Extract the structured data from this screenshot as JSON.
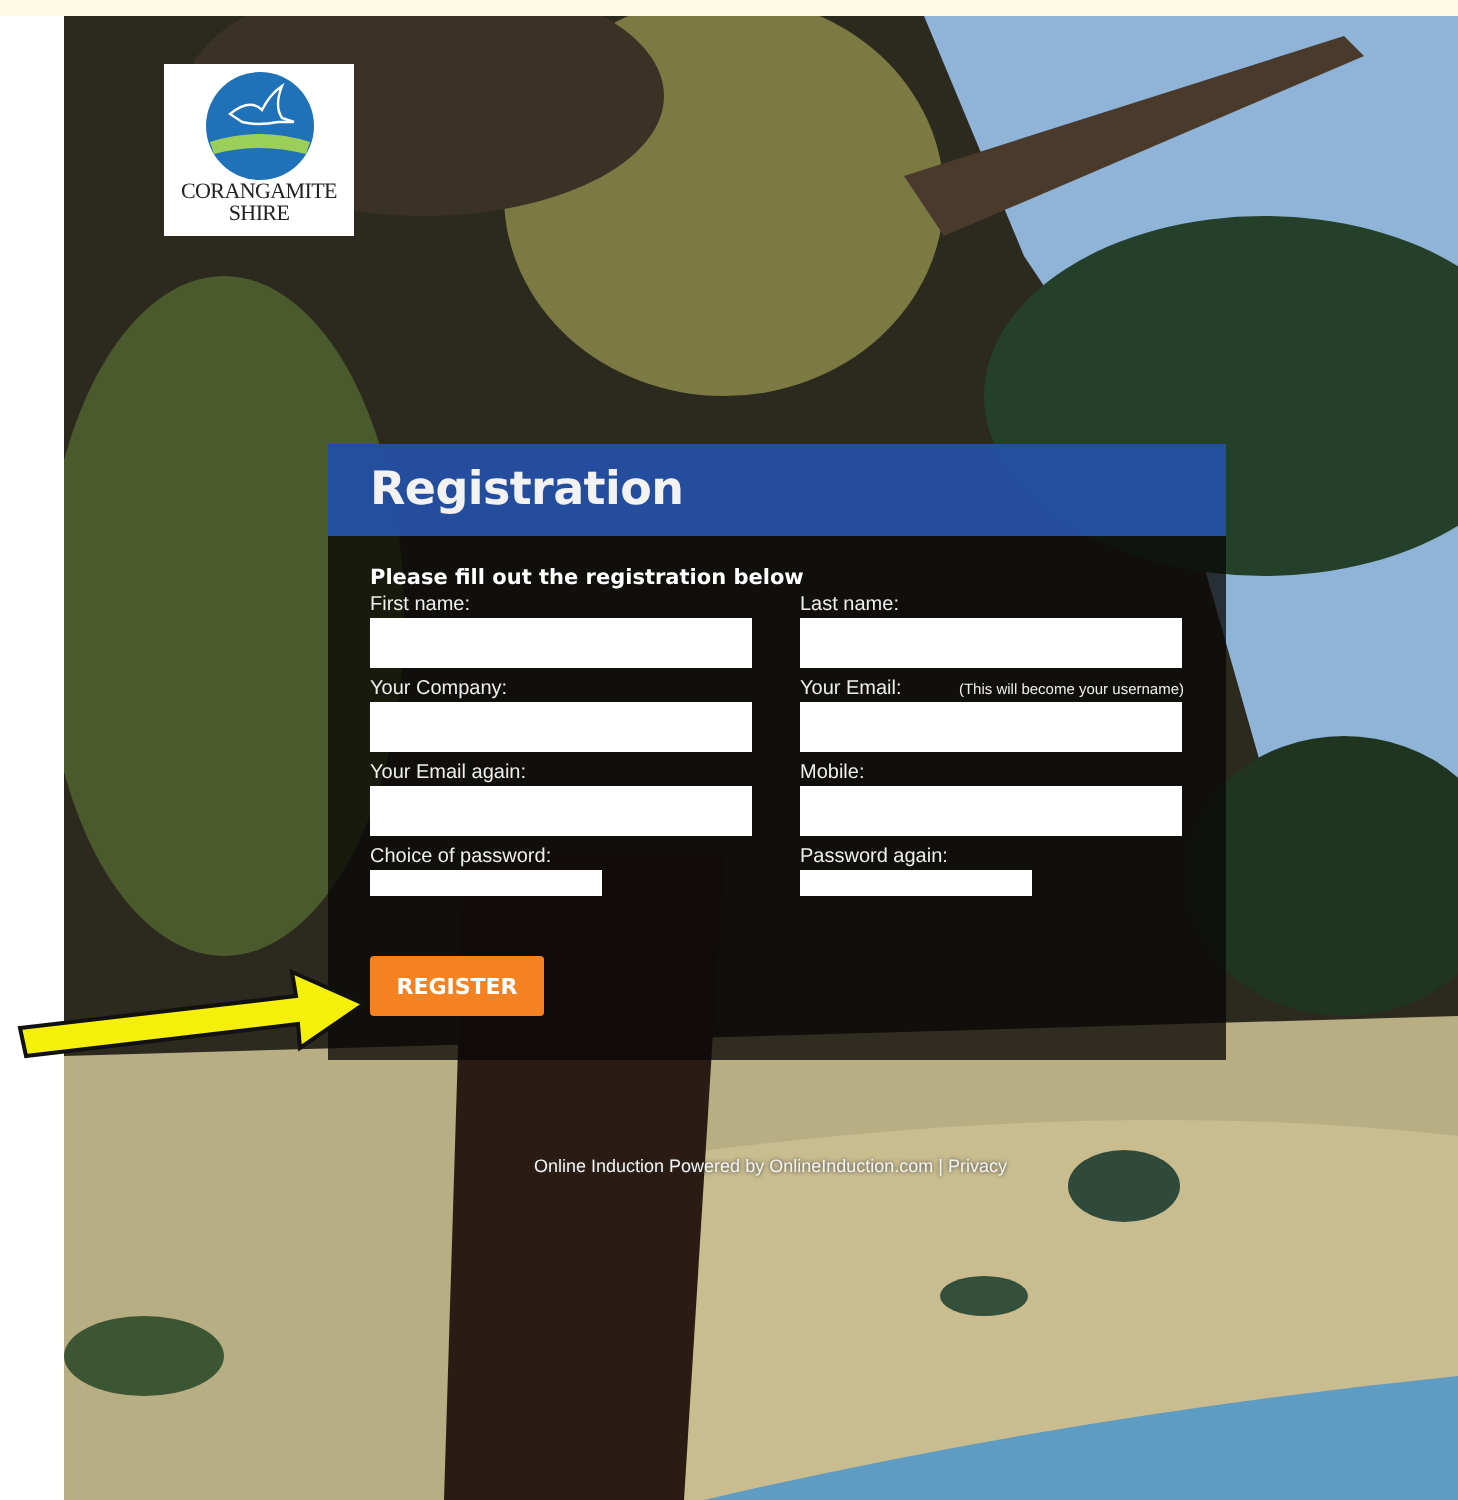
{
  "logo": {
    "lines": [
      "CORANGAMITE",
      "SHIRE"
    ]
  },
  "form": {
    "title": "Registration",
    "intro": "Please fill out the registration below",
    "fields": [
      {
        "label": "First name:",
        "kind": "text"
      },
      {
        "label": "Last name:",
        "kind": "text"
      },
      {
        "label": "Your Company:",
        "kind": "text"
      },
      {
        "label": "Your Email:",
        "note": "(This will become your username)",
        "kind": "text"
      },
      {
        "label": "Your Email again:",
        "kind": "text"
      },
      {
        "label": "Mobile:",
        "kind": "text"
      },
      {
        "label": "Choice of password:",
        "kind": "password"
      },
      {
        "label": "Password again:",
        "kind": "password"
      }
    ],
    "submit": "REGISTER"
  },
  "footer": {
    "text": "Online Induction Powered by",
    "link": "OnlineInduction.com",
    "separator": "|",
    "privacy": "Privacy"
  }
}
